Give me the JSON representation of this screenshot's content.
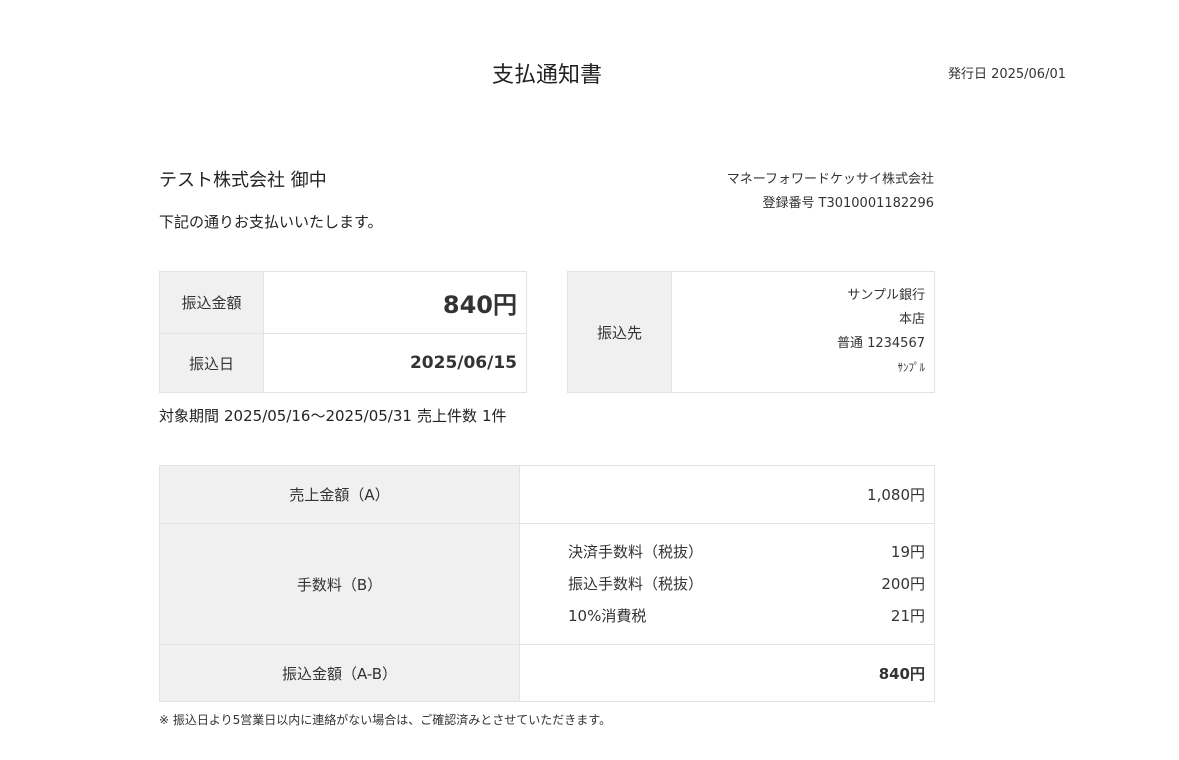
{
  "document": {
    "title": "支払通知書",
    "issue_date_label": "発行日",
    "issue_date": "2025/06/01"
  },
  "recipient": {
    "name": "テスト株式会社 御中",
    "message": "下記の通りお支払いいたします。"
  },
  "issuer": {
    "company": "マネーフォワードケッサイ株式会社",
    "registration_label": "登録番号",
    "registration_number": "T3010001182296"
  },
  "payment": {
    "amount_label": "振込金額",
    "amount": "840円",
    "date_label": "振込日",
    "date": "2025/06/15"
  },
  "bank": {
    "label": "振込先",
    "bank_name": "サンプル銀行",
    "branch": "本店",
    "account": "普通 1234567",
    "holder": "ｻﾝﾌﾟﾙ"
  },
  "period": {
    "label": "対象期間",
    "range": "2025/05/16〜2025/05/31",
    "count_label": "売上件数",
    "count": "1件"
  },
  "summary": {
    "sales_label": "売上金額（A）",
    "sales_value": "1,080円",
    "fees_label": "手数料（B）",
    "fees": [
      {
        "label": "決済手数料（税抜）",
        "value": "19円"
      },
      {
        "label": "振込手数料（税抜）",
        "value": "200円"
      },
      {
        "label": "10%消費税",
        "value": "21円"
      }
    ],
    "net_label": "振込金額（A-B）",
    "net_value": "840円"
  },
  "note": "※ 振込日より5営業日以内に連絡がない場合は、ご確認済みとさせていただきます。"
}
